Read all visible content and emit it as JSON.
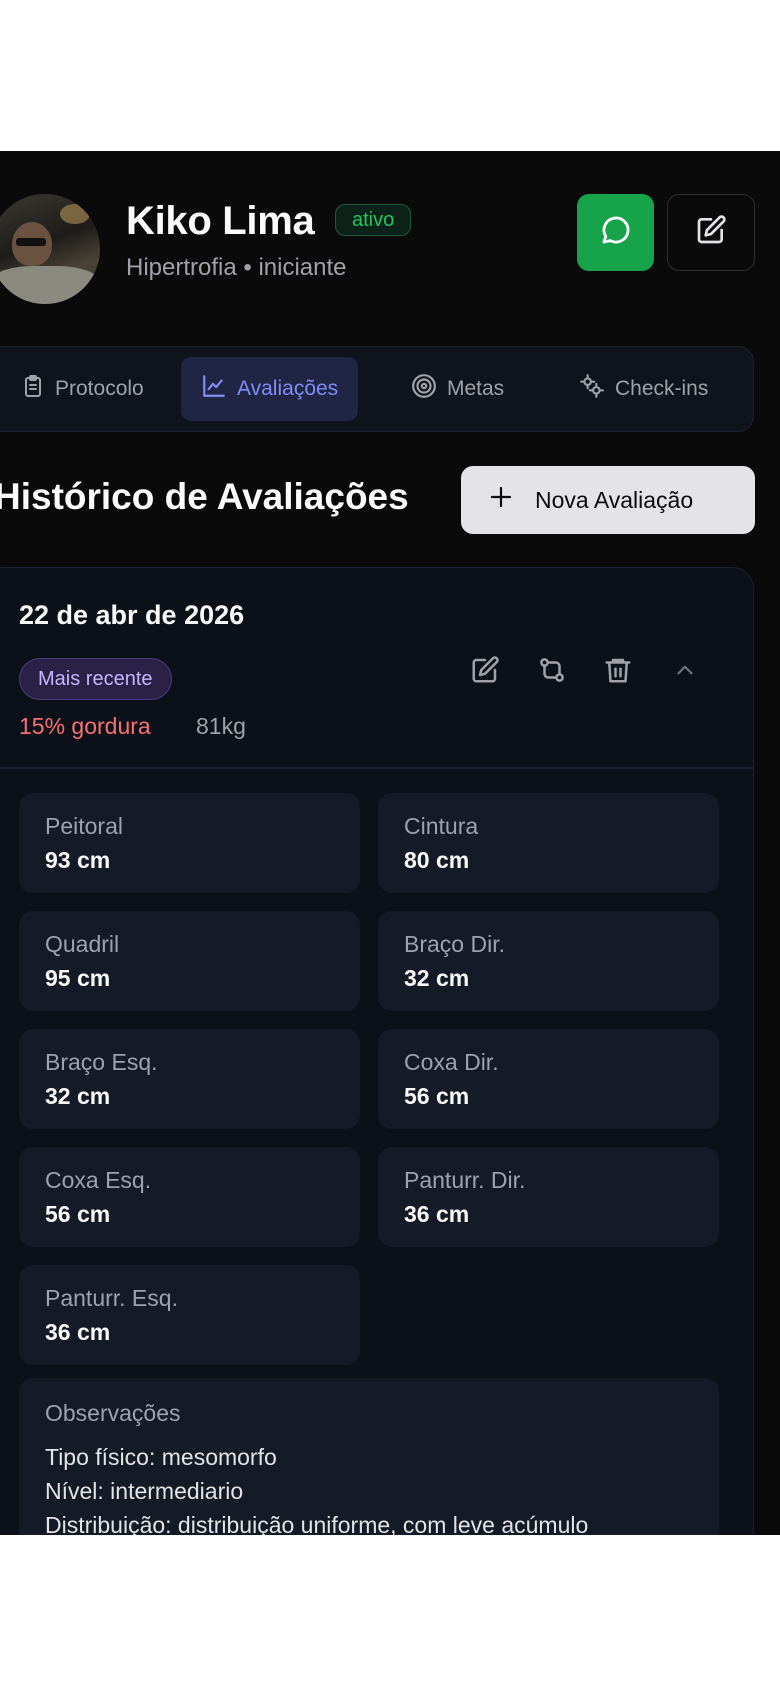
{
  "profile": {
    "name": "Kiko Lima",
    "status": "ativo",
    "subtitle": "Hipertrofia • iniciante"
  },
  "icons": {
    "whatsapp": "message-circle-icon",
    "edit": "pencil-square-icon",
    "compare": "git-compare-icon",
    "delete": "trash-icon",
    "collapse": "chevron-up-icon"
  },
  "tabs": [
    {
      "label": "Protocolo",
      "icon": "clipboard-icon",
      "active": false
    },
    {
      "label": "Avaliações",
      "icon": "line-chart-icon",
      "active": true
    },
    {
      "label": "Metas",
      "icon": "target-icon",
      "active": false
    },
    {
      "label": "Check-ins",
      "icon": "gear-icon",
      "active": false
    }
  ],
  "section": {
    "title": "Histórico de Avaliações",
    "new_button": "Nova Avaliação"
  },
  "evaluation": {
    "date": "22 de abr de 2026",
    "badge": "Mais recente",
    "body_fat": "15% gordura",
    "weight": "81kg",
    "measurements": [
      {
        "label": "Peitoral",
        "value": "93 cm"
      },
      {
        "label": "Cintura",
        "value": "80 cm"
      },
      {
        "label": "Quadril",
        "value": "95 cm"
      },
      {
        "label": "Braço Dir.",
        "value": "32 cm"
      },
      {
        "label": "Braço Esq.",
        "value": "32 cm"
      },
      {
        "label": "Coxa Dir.",
        "value": "56 cm"
      },
      {
        "label": "Coxa Esq.",
        "value": "56 cm"
      },
      {
        "label": "Panturr. Dir.",
        "value": "36 cm"
      },
      {
        "label": "Panturr. Esq.",
        "value": "36 cm"
      }
    ],
    "notes_title": "Observações",
    "notes_lines": [
      "Tipo físico: mesomorfo",
      "Nível: intermediario",
      "Distribuição: distribuição uniforme, com leve acúmulo"
    ]
  },
  "colors": {
    "background": "#0a0a0b",
    "accent": "#818cf8",
    "whatsapp_green": "#16a34a",
    "status_green": "#22c55e",
    "fat_red": "#f87171"
  }
}
